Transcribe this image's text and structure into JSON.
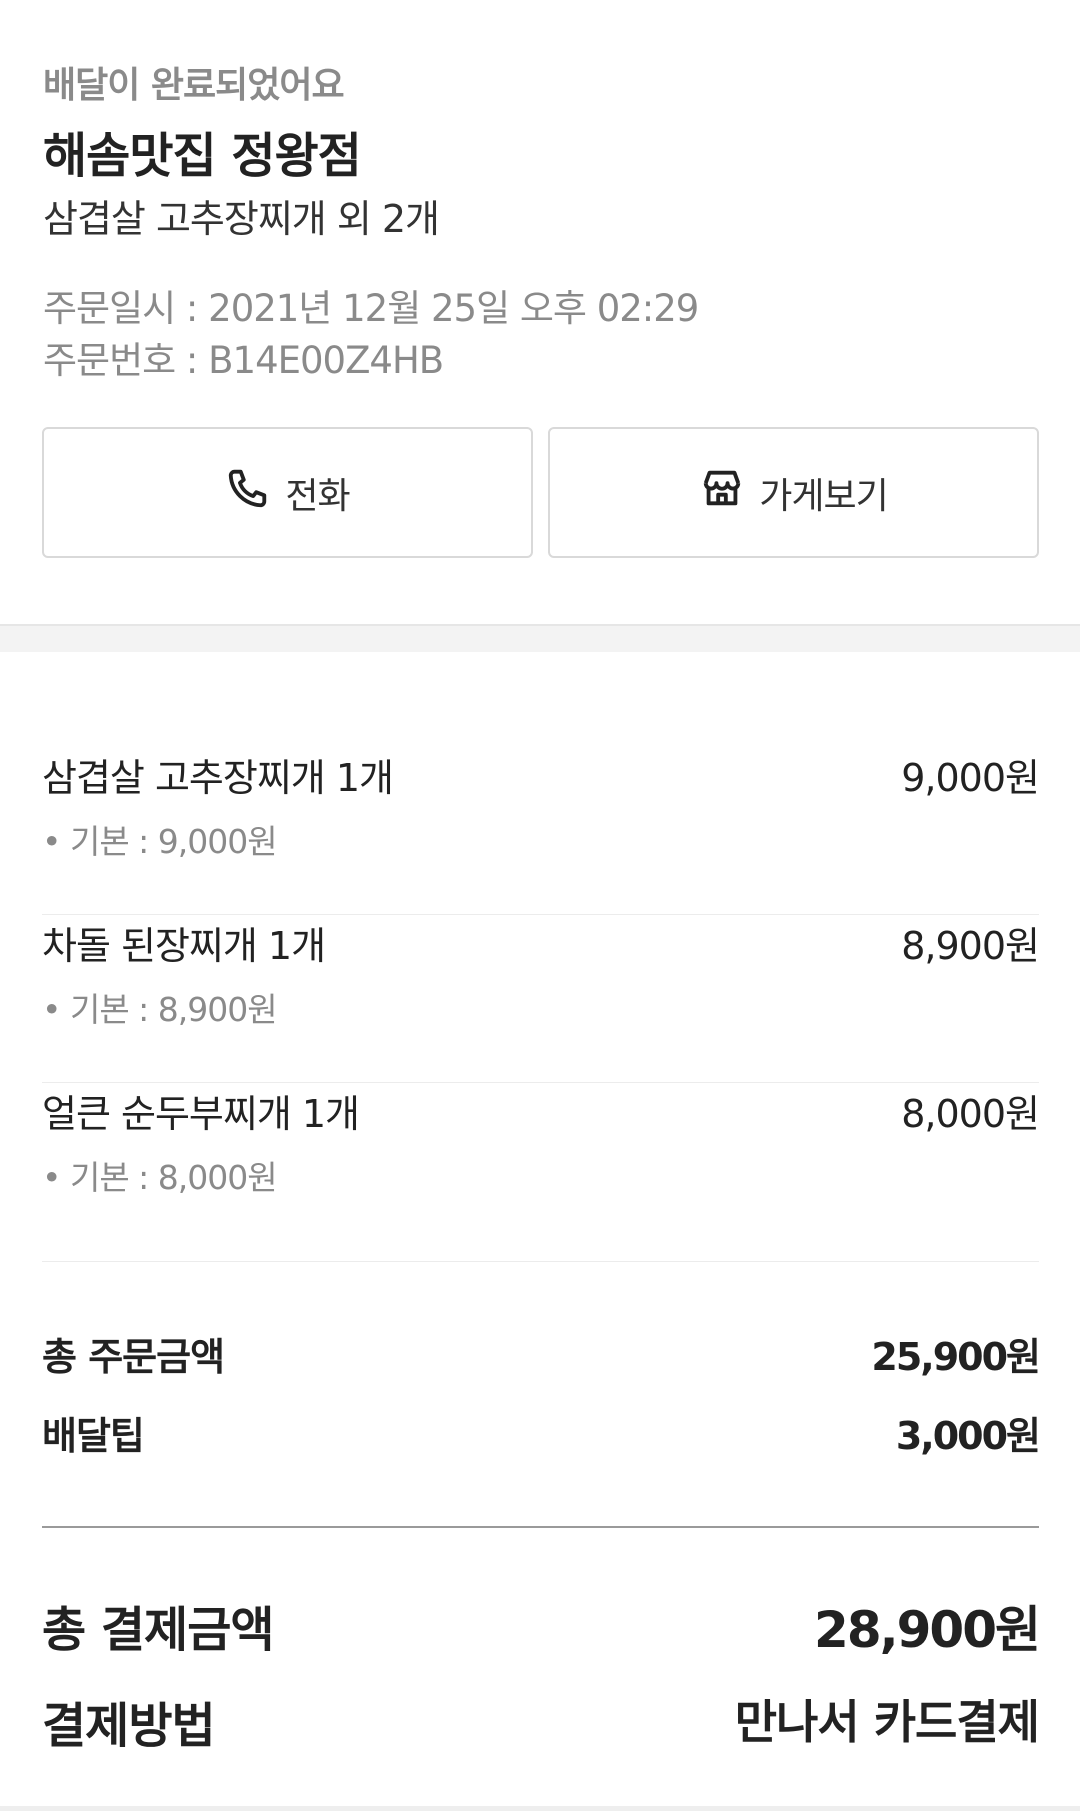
{
  "header": {
    "status": "배달이 완료되었어요",
    "store_name": "해솜맛집 정왕점",
    "order_summary": "삼겹살 고추장찌개 외 2개",
    "order_date": "주문일시 : 2021년 12월 25일 오후 02:29",
    "order_number": "주문번호 : B14E00Z4HB"
  },
  "actions": {
    "call_label": "전화",
    "call_icon": "phone-icon",
    "store_label": "가게보기",
    "store_icon": "store-icon"
  },
  "items": [
    {
      "name": "삼겹살 고추장찌개 1개",
      "price": "9,000원",
      "option": "• 기본 : 9,000원"
    },
    {
      "name": "차돌 된장찌개 1개",
      "price": "8,900원",
      "option": "• 기본 : 8,900원"
    },
    {
      "name": "얼큰 순두부찌개 1개",
      "price": "8,000원",
      "option": "• 기본 : 8,000원"
    }
  ],
  "summary": {
    "order_total_label": "총 주문금액",
    "order_total_value": "25,900원",
    "delivery_tip_label": "배달팁",
    "delivery_tip_value": "3,000원"
  },
  "payment": {
    "total_label": "총 결제금액",
    "total_value": "28,900원",
    "method_label": "결제방법",
    "method_value": "만나서 카드결제"
  }
}
